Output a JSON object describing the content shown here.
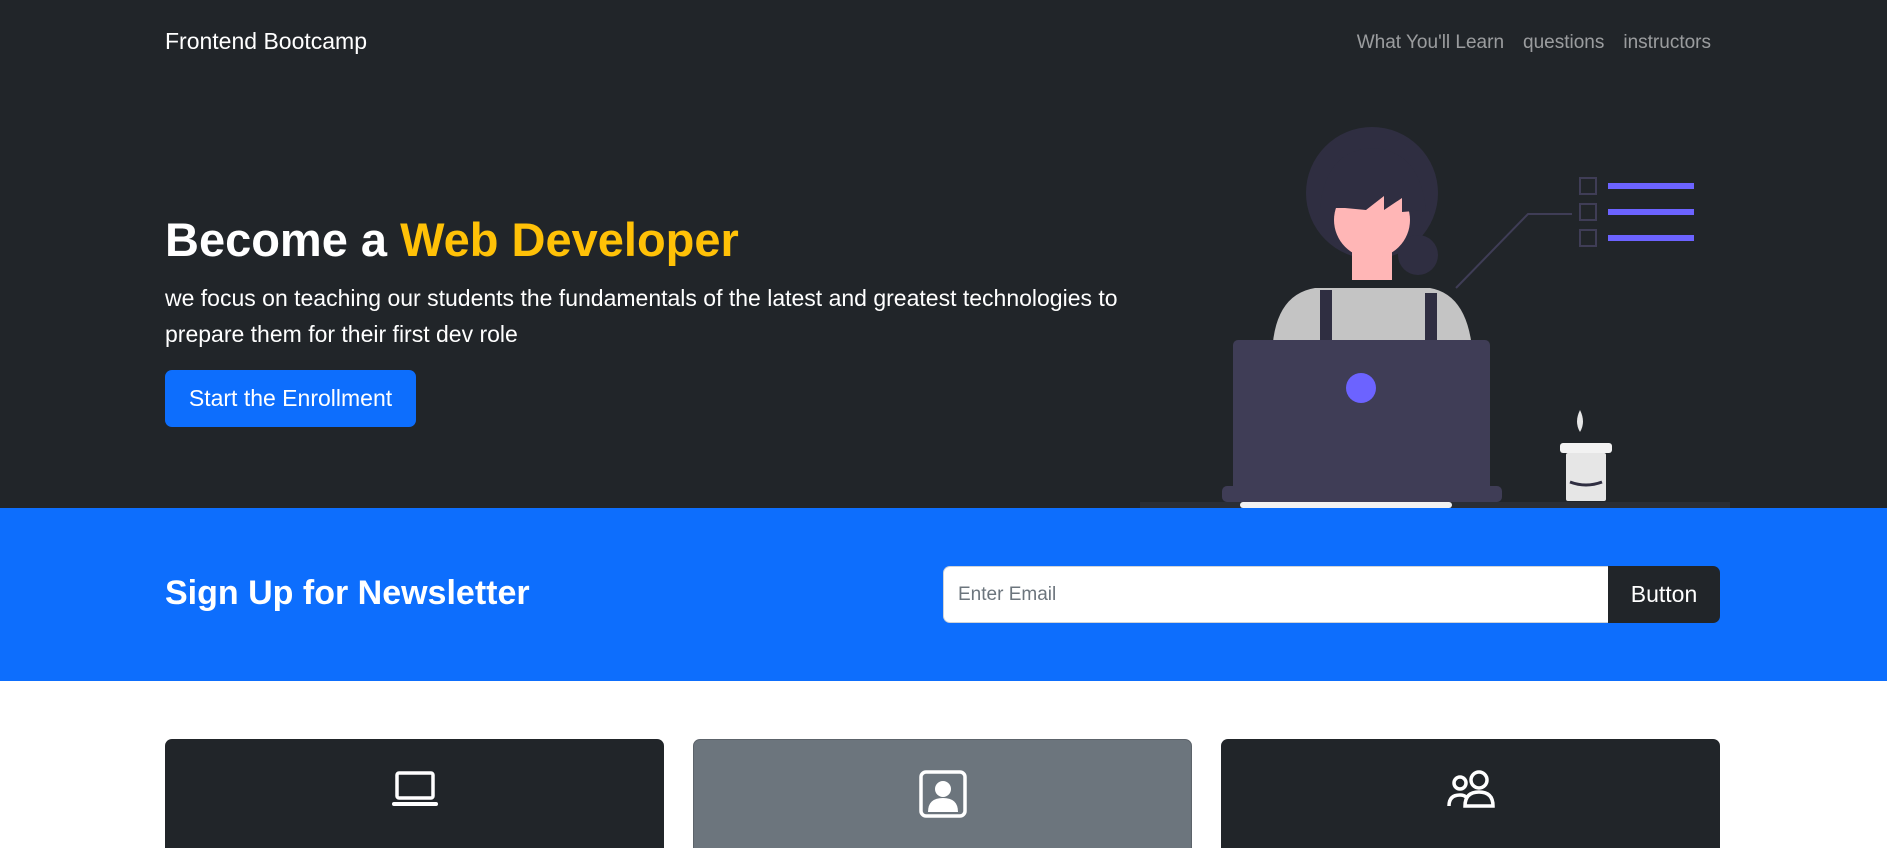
{
  "nav": {
    "brand": "Frontend Bootcamp",
    "links": [
      "What You'll Learn",
      "questions",
      "instructors"
    ]
  },
  "hero": {
    "title_prefix": "Become a",
    "title_accent": "Web Developer",
    "subtitle": "we focus on teaching our students the fundamentals of the latest and greatest technologies to prepare them for their first dev role",
    "cta_label": "Start the Enrollment"
  },
  "newsletter": {
    "title": "Sign Up for Newsletter",
    "email_placeholder": "Enter Email",
    "button_label": "Button"
  },
  "cards": [
    {
      "icon": "laptop-icon"
    },
    {
      "icon": "person-square-icon"
    },
    {
      "icon": "people-icon"
    }
  ],
  "colors": {
    "dark": "#212529",
    "primary": "#0d6efd",
    "accent": "#ffc107",
    "secondary": "#6c757d",
    "illustration_purple": "#6c63ff"
  }
}
